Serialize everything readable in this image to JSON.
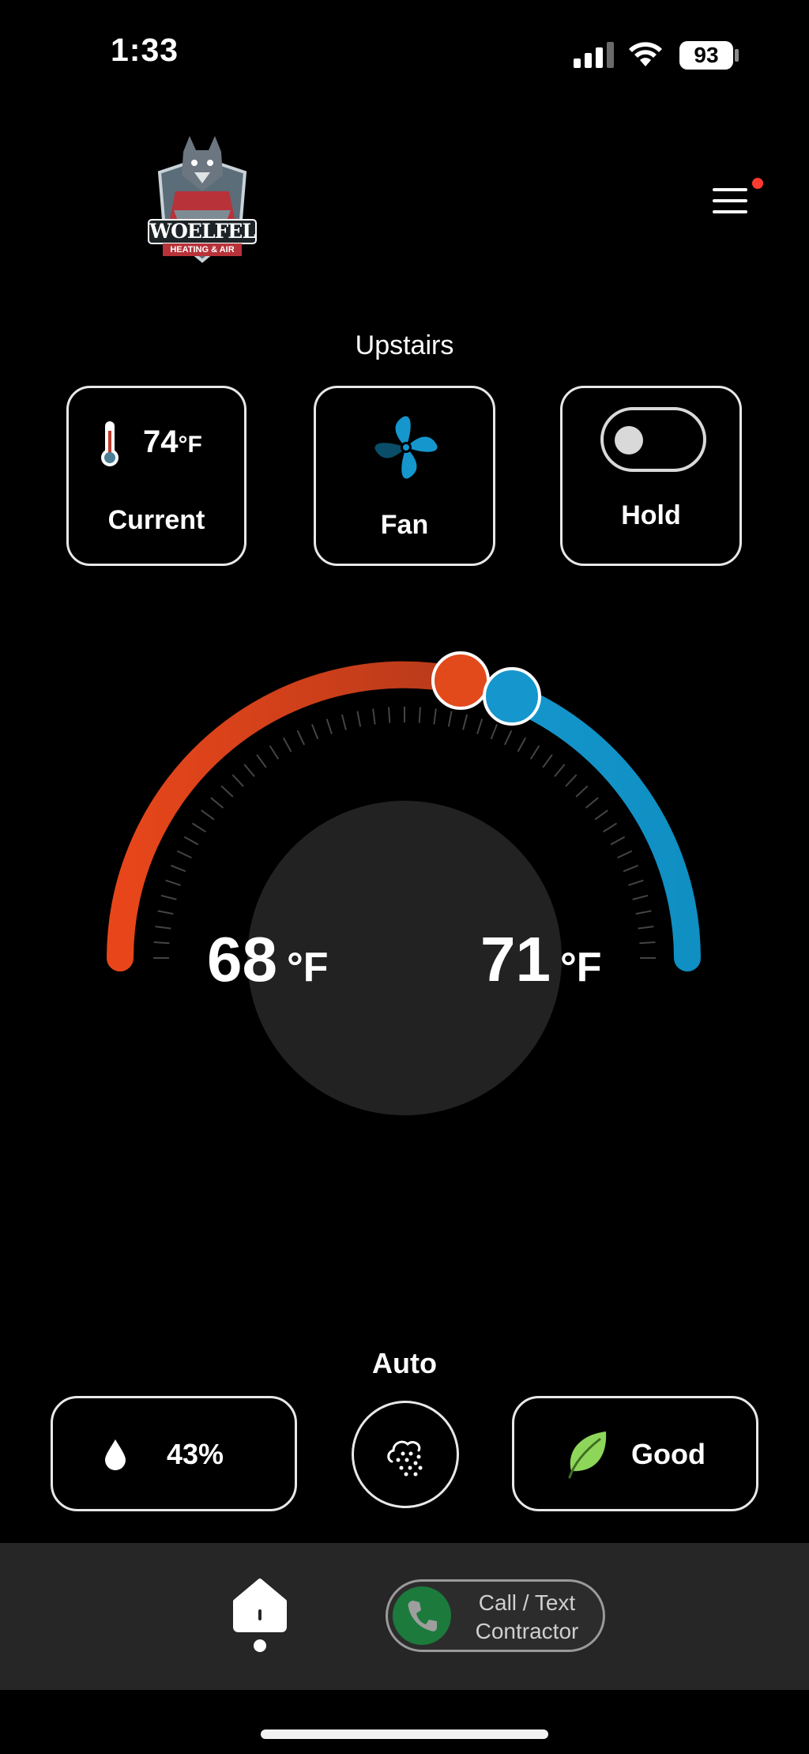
{
  "status_bar": {
    "time": "1:33",
    "battery": "93",
    "signal_icon": "cellular-signal-icon",
    "wifi_icon": "wifi-icon"
  },
  "header": {
    "logo_text": "WOELFEL",
    "logo_subtext": "HEATING & AIR",
    "menu_icon": "hamburger-menu-icon",
    "notification_color": "#ff3b30"
  },
  "zone": {
    "name": "Upstairs"
  },
  "cards": {
    "current": {
      "value": "74",
      "unit": "°F",
      "label": "Current",
      "icon": "thermometer-icon"
    },
    "fan": {
      "label": "Fan",
      "icon": "fan-icon"
    },
    "hold": {
      "label": "Hold",
      "icon": "toggle-icon",
      "on": false
    }
  },
  "dial": {
    "heat_setpoint": "68",
    "cool_setpoint": "71",
    "unit": "°F",
    "heat_color": "#e24a1c",
    "cool_color": "#1596cc"
  },
  "mode": {
    "label": "Auto"
  },
  "bottom_controls": {
    "humidity": {
      "value": "43%",
      "icon": "water-drop-icon"
    },
    "filter_icon": "air-filter-icon",
    "air_quality": {
      "value": "Good",
      "icon": "leaf-icon"
    }
  },
  "bottom_bar": {
    "home_icon": "home-icon",
    "contact_line1": "Call / Text",
    "contact_line2": "Contractor",
    "phone_icon": "phone-icon"
  }
}
